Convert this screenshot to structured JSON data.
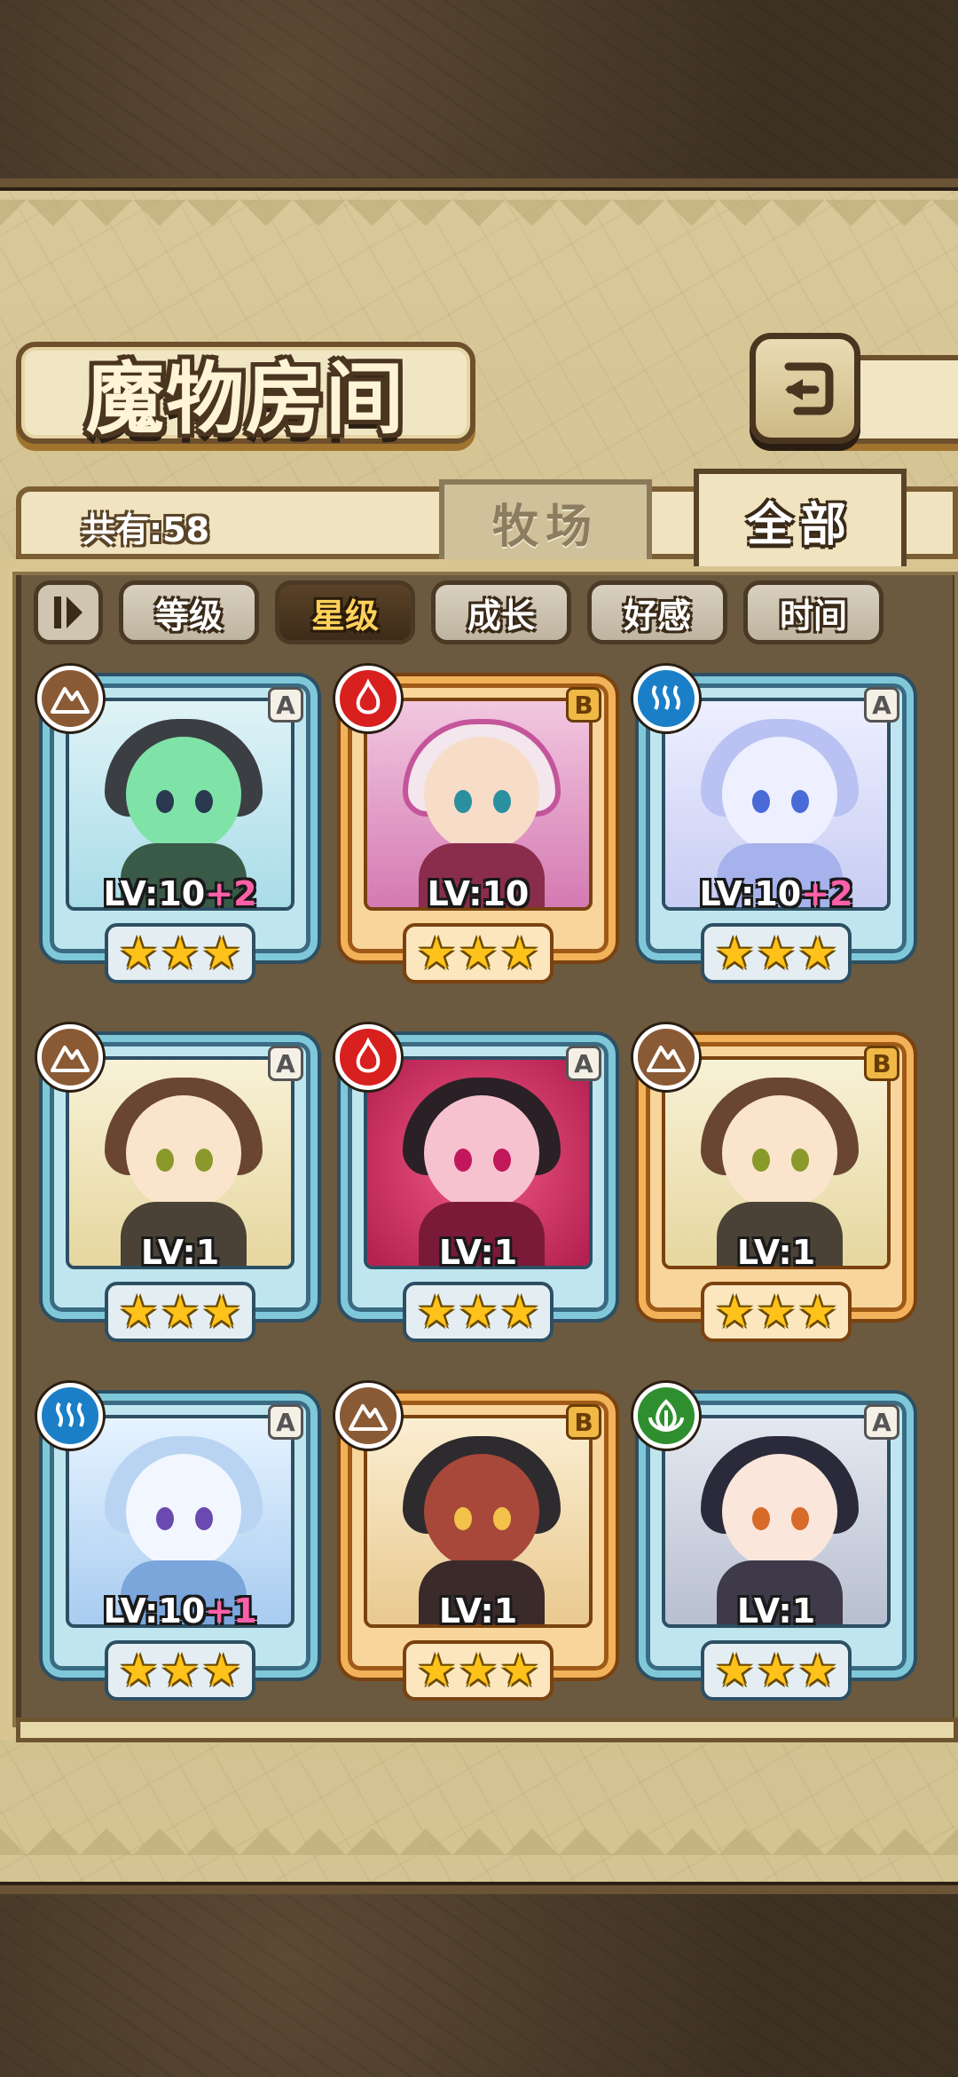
{
  "title": "魔物房间",
  "count_label": "共有:58",
  "tabs": {
    "ranch": "牧场",
    "all": "全部"
  },
  "sort": [
    "等级",
    "星级",
    "成长",
    "好感",
    "时间"
  ],
  "active_sort": "星级",
  "colors": {
    "card_a": "#7fc8da",
    "card_b": "#f2b25a",
    "earth": "#8a5a35",
    "fire": "#d8201f",
    "water": "#1b7fc7",
    "grass": "#2f8f2f"
  },
  "monsters": [
    {
      "element": "earth-icon",
      "rank": "A",
      "level": "LV:10",
      "plus": "+2",
      "stars": 3
    },
    {
      "element": "fire-icon",
      "rank": "B",
      "level": "LV:10",
      "plus": "",
      "stars": 3
    },
    {
      "element": "water-icon",
      "rank": "A",
      "level": "LV:10",
      "plus": "+2",
      "stars": 3
    },
    {
      "element": "earth-icon",
      "rank": "A",
      "level": "LV:1",
      "plus": "",
      "stars": 3
    },
    {
      "element": "fire-icon",
      "rank": "A",
      "level": "LV:1",
      "plus": "",
      "stars": 3
    },
    {
      "element": "earth-icon",
      "rank": "B",
      "level": "LV:1",
      "plus": "",
      "stars": 3
    },
    {
      "element": "water-icon",
      "rank": "A",
      "level": "LV:10",
      "plus": "+1",
      "stars": 3
    },
    {
      "element": "earth-icon",
      "rank": "B",
      "level": "LV:1",
      "plus": "",
      "stars": 3
    },
    {
      "element": "grass-icon",
      "rank": "A",
      "level": "LV:1",
      "plus": "",
      "stars": 3
    }
  ]
}
